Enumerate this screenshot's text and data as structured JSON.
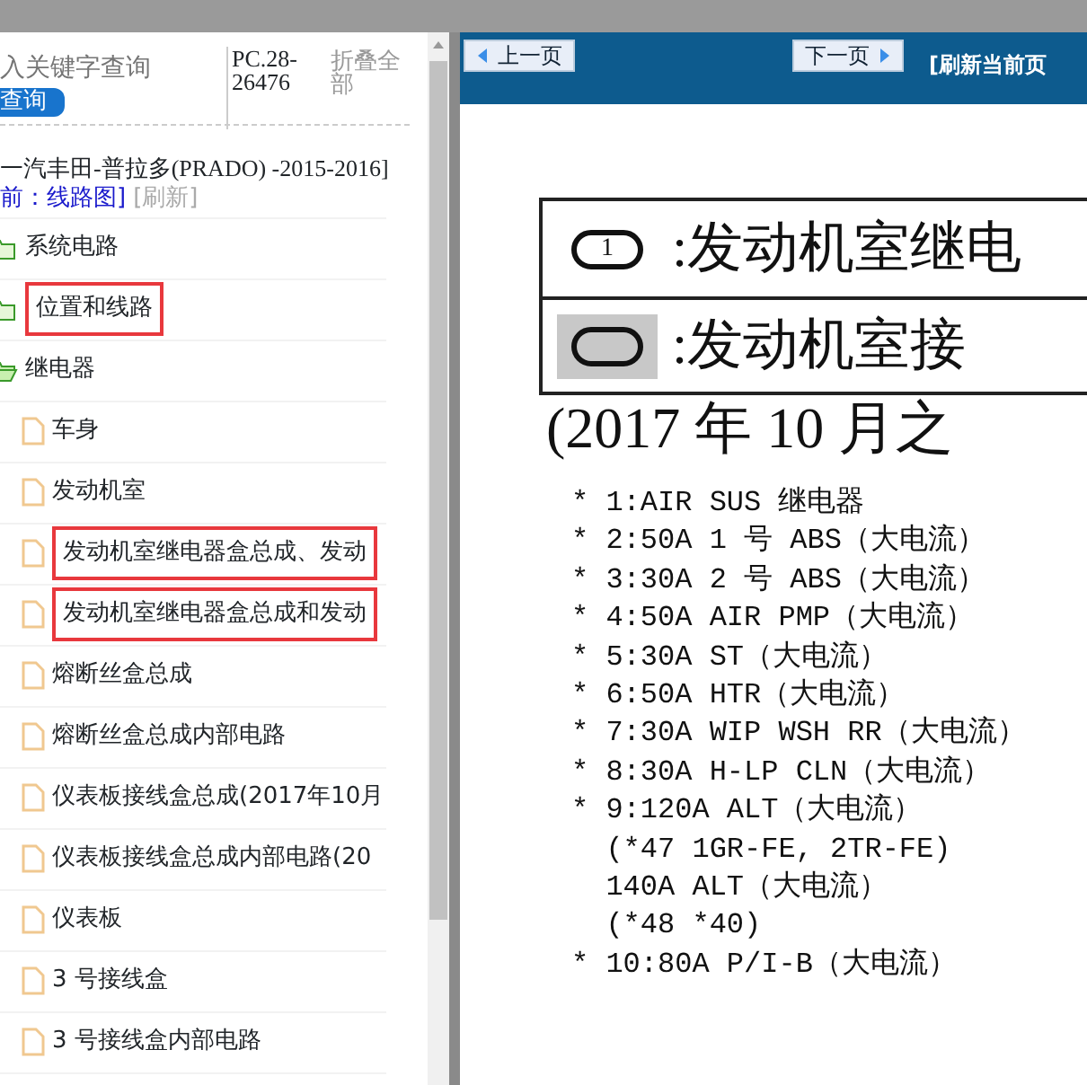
{
  "sidebar": {
    "search": {
      "placeholder": "入关键字查询",
      "button": "查询"
    },
    "code": "PC.28-26476",
    "collapse_all": "折叠全部",
    "vehicle_title": "一汽丰田-普拉多(PRADO) -2015-2016]",
    "current": "前：线路图]",
    "refresh": "[刷新]",
    "tree": [
      {
        "label": "系统电路",
        "kind": "folder",
        "expanded": false,
        "highlighted": false
      },
      {
        "label": "位置和线路",
        "kind": "folder",
        "expanded": false,
        "highlighted": true
      },
      {
        "label": "继电器",
        "kind": "folder",
        "expanded": true,
        "highlighted": false,
        "children": [
          {
            "label": "车身",
            "kind": "file",
            "highlighted": false
          },
          {
            "label": "发动机室",
            "kind": "file",
            "highlighted": false
          },
          {
            "label": "发动机室继电器盒总成、发动",
            "kind": "file",
            "highlighted": true
          },
          {
            "label": "发动机室继电器盒总成和发动",
            "kind": "file",
            "highlighted": true
          },
          {
            "label": "熔断丝盒总成",
            "kind": "file",
            "highlighted": false
          },
          {
            "label": "熔断丝盒总成内部电路",
            "kind": "file",
            "highlighted": false
          },
          {
            "label": "仪表板接线盒总成(2017年10月",
            "kind": "file",
            "highlighted": false
          },
          {
            "label": "仪表板接线盒总成内部电路(20",
            "kind": "file",
            "highlighted": false
          },
          {
            "label": "仪表板",
            "kind": "file",
            "highlighted": false
          },
          {
            "label": "3 号接线盒",
            "kind": "file",
            "highlighted": false
          },
          {
            "label": "3 号接线盒内部电路",
            "kind": "file",
            "highlighted": false
          }
        ]
      }
    ]
  },
  "toolbar": {
    "prev": "上一页",
    "next": "下一页",
    "refresh": "[刷新当前页"
  },
  "document": {
    "legend": [
      {
        "symbol": "1",
        "shaded": false,
        "text": ":发动机室继电"
      },
      {
        "shaded": true,
        "text": ":发动机室接"
      }
    ],
    "date_line": "(2017 年 10 月之",
    "lines": [
      "* 1:AIR SUS 继电器",
      "* 2:50A 1 号 ABS（大电流）",
      "* 3:30A 2 号 ABS（大电流）",
      "* 4:50A AIR PMP（大电流）",
      "* 5:30A ST（大电流）",
      "* 6:50A HTR（大电流）",
      "* 7:30A WIP WSH RR（大电流）",
      "* 8:30A H-LP CLN（大电流）",
      "* 9:120A ALT（大电流）",
      "  (*47 1GR-FE, 2TR-FE)",
      "  140A ALT（大电流）",
      "  (*48 *40)",
      "* 10:80A P/I-B（大电流）"
    ]
  }
}
